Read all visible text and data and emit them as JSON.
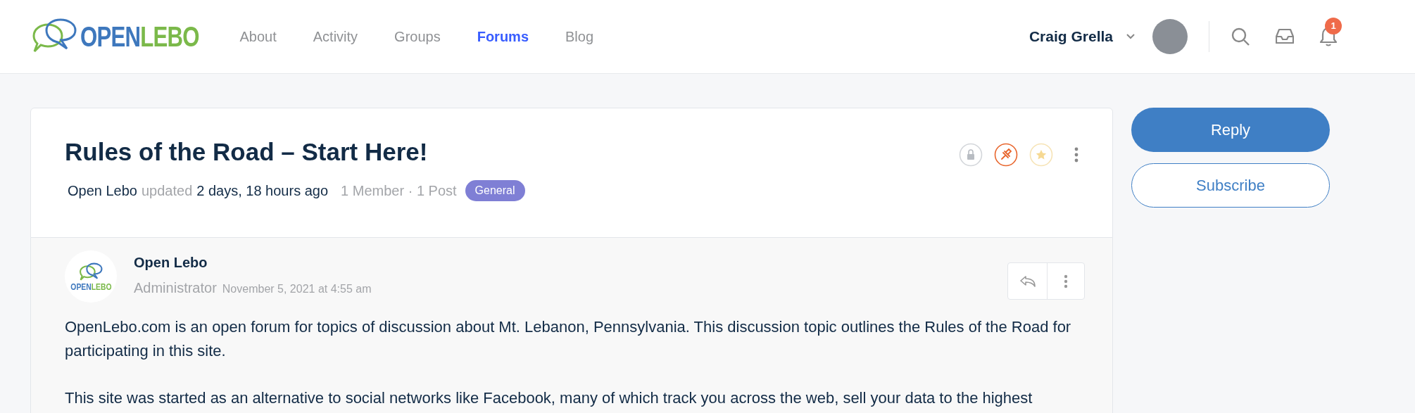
{
  "logo": {
    "first": "OPEN",
    "second": "LEBO"
  },
  "nav": [
    {
      "label": "About",
      "selected": false
    },
    {
      "label": "Activity",
      "selected": false
    },
    {
      "label": "Groups",
      "selected": false
    },
    {
      "label": "Forums",
      "selected": true
    },
    {
      "label": "Blog",
      "selected": false
    }
  ],
  "user": {
    "name": "Craig Grella"
  },
  "notifications": {
    "count": "1"
  },
  "topic": {
    "title": "Rules of the Road – Start Here!",
    "author": "Open Lebo",
    "updated_label": "updated",
    "updated": "2 days, 18 hours ago",
    "stats": "1 Member · 1 Post",
    "tag": "General",
    "status_icons": [
      {
        "kind": "lock",
        "on": false
      },
      {
        "kind": "pin",
        "on": true
      },
      {
        "kind": "star",
        "on": false
      }
    ]
  },
  "actions": [
    "Reply",
    "Subscribe"
  ],
  "post": {
    "author": "Open Lebo",
    "avatar_logo": {
      "first": "OPEN",
      "second": "LEBO"
    },
    "role": "Administrator",
    "date": "November 5, 2021 at 4:55 am",
    "paragraphs": [
      "OpenLebo.com is an open forum for topics of discussion about Mt. Lebanon, Pennsylvania. This discussion topic outlines the Rules of the Road for participating in this site.",
      "This site was started as an alternative to social networks like Facebook, many of which track you across the web, sell your data to the highest"
    ]
  }
}
